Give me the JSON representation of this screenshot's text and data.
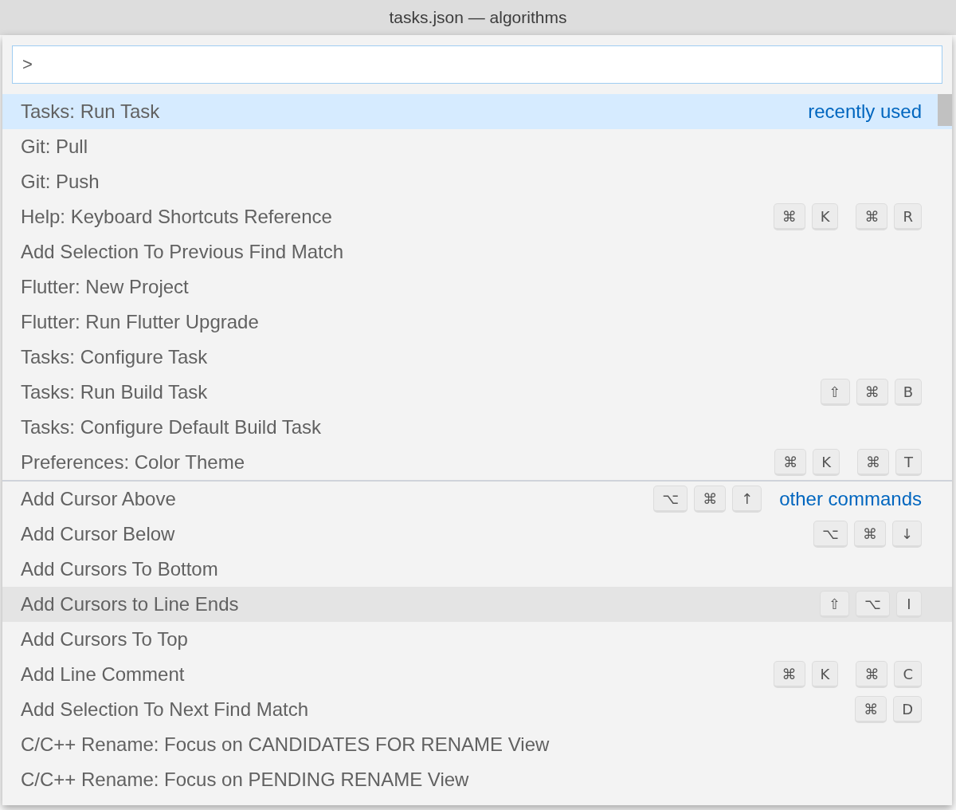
{
  "window": {
    "title": "tasks.json — algorithms"
  },
  "input": {
    "value": ">"
  },
  "groups": [
    {
      "label": "recently used",
      "items": [
        {
          "label": "Tasks: Run Task",
          "selected": true,
          "hovered": false
        },
        {
          "label": "Git: Pull",
          "selected": false,
          "hovered": false
        },
        {
          "label": "Git: Push",
          "selected": false,
          "hovered": false
        },
        {
          "label": "Help: Keyboard Shortcuts Reference",
          "selected": false,
          "hovered": false,
          "shortcut": [
            [
              "⌘",
              "K"
            ],
            [
              "⌘",
              "R"
            ]
          ]
        },
        {
          "label": "Add Selection To Previous Find Match",
          "selected": false,
          "hovered": false
        },
        {
          "label": "Flutter: New Project",
          "selected": false,
          "hovered": false
        },
        {
          "label": "Flutter: Run Flutter Upgrade",
          "selected": false,
          "hovered": false
        },
        {
          "label": "Tasks: Configure Task",
          "selected": false,
          "hovered": false
        },
        {
          "label": "Tasks: Run Build Task",
          "selected": false,
          "hovered": false,
          "shortcut": [
            [
              "⇧",
              "⌘",
              "B"
            ]
          ]
        },
        {
          "label": "Tasks: Configure Default Build Task",
          "selected": false,
          "hovered": false
        },
        {
          "label": "Preferences: Color Theme",
          "selected": false,
          "hovered": false,
          "shortcut": [
            [
              "⌘",
              "K"
            ],
            [
              "⌘",
              "T"
            ]
          ]
        }
      ]
    },
    {
      "label": "other commands",
      "items": [
        {
          "label": "Add Cursor Above",
          "selected": false,
          "hovered": false,
          "shortcut": [
            [
              "⌥",
              "⌘",
              "↑"
            ]
          ]
        },
        {
          "label": "Add Cursor Below",
          "selected": false,
          "hovered": false,
          "shortcut": [
            [
              "⌥",
              "⌘",
              "↓"
            ]
          ]
        },
        {
          "label": "Add Cursors To Bottom",
          "selected": false,
          "hovered": false
        },
        {
          "label": "Add Cursors to Line Ends",
          "selected": false,
          "hovered": true,
          "shortcut": [
            [
              "⇧",
              "⌥",
              "I"
            ]
          ]
        },
        {
          "label": "Add Cursors To Top",
          "selected": false,
          "hovered": false
        },
        {
          "label": "Add Line Comment",
          "selected": false,
          "hovered": false,
          "shortcut": [
            [
              "⌘",
              "K"
            ],
            [
              "⌘",
              "C"
            ]
          ]
        },
        {
          "label": "Add Selection To Next Find Match",
          "selected": false,
          "hovered": false,
          "shortcut": [
            [
              "⌘",
              "D"
            ]
          ]
        },
        {
          "label": "C/C++ Rename: Focus on CANDIDATES FOR RENAME View",
          "selected": false,
          "hovered": false
        },
        {
          "label": "C/C++ Rename: Focus on PENDING RENAME View",
          "selected": false,
          "hovered": false
        }
      ]
    }
  ]
}
